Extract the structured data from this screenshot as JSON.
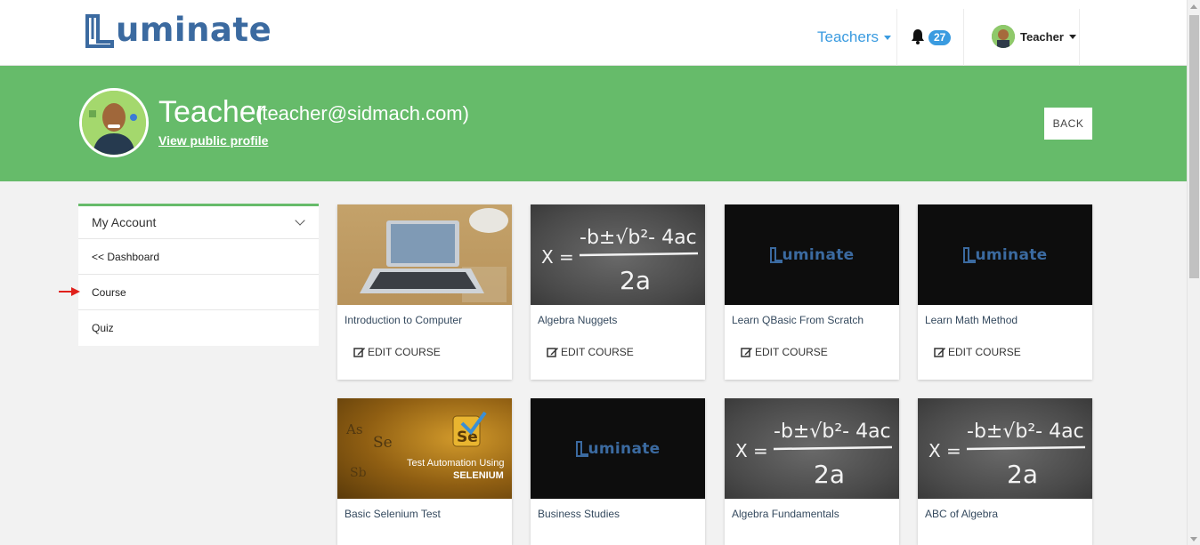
{
  "navbar": {
    "logo_text": "uminate",
    "teachers_label": "Teachers",
    "notification_count": "27",
    "user_label": "Teacher"
  },
  "banner": {
    "name": "Teacher",
    "email": "(teacher@sidmach.com)",
    "public_profile_link": "View public profile",
    "back_label": "BACK",
    "color": "#66bb6a"
  },
  "sidebar": {
    "header": "My Account",
    "items": [
      {
        "label": "<< Dashboard"
      },
      {
        "label": "Course"
      },
      {
        "label": "Quiz"
      }
    ]
  },
  "courses": [
    {
      "title": "Introduction to Computer",
      "edit_label": "EDIT COURSE",
      "thumb": "laptop-photo"
    },
    {
      "title": "Algebra Nuggets",
      "edit_label": "EDIT COURSE",
      "thumb": "quadratic-formula-chalkboard"
    },
    {
      "title": "Learn QBasic From Scratch",
      "edit_label": "EDIT COURSE",
      "thumb": "luminate-logo-black"
    },
    {
      "title": "Learn Math Method",
      "edit_label": "EDIT COURSE",
      "thumb": "luminate-logo-black"
    },
    {
      "title": "Basic Selenium Test",
      "thumb": "selenium-banner"
    },
    {
      "title": "Business Studies",
      "thumb": "luminate-logo-black"
    },
    {
      "title": "Algebra Fundamentals",
      "thumb": "quadratic-formula-chalkboard"
    },
    {
      "title": "ABC of Algebra",
      "thumb": "quadratic-formula-chalkboard"
    }
  ],
  "thumb_text": {
    "mini_logo": "uminate",
    "selenium_line1": "Test Automation Using",
    "selenium_line2": "SELENIUM",
    "formula_x": "X =",
    "formula_top": "-b±√b²- 4ac",
    "formula_bottom": "2a"
  },
  "colors": {
    "accent": "#3a9be0",
    "brand": "#3b6aa0"
  }
}
